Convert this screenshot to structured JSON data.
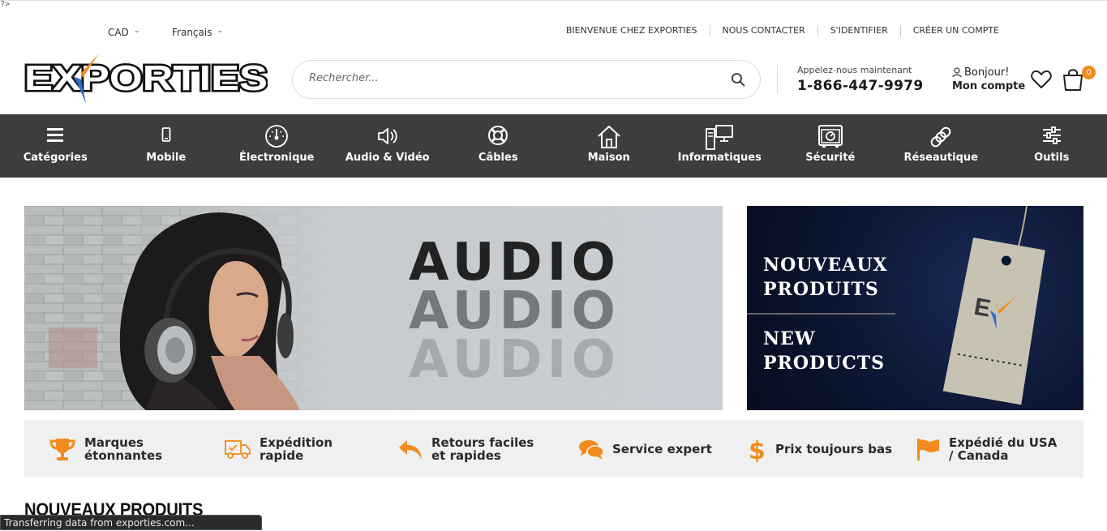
{
  "stray_text": "?>",
  "topbar": {
    "currency": "CAD",
    "language": "Français",
    "links": [
      "BIENVENUE CHEZ EXPORTIES",
      "NOUS CONTACTER",
      "S'IDENTIFIER",
      "CRÉER UN COMPTE"
    ]
  },
  "header": {
    "logo_text": "EXPORTIES",
    "search_placeholder": "Rechercher...",
    "phone_label": "Appelez-nous maintenant",
    "phone_number": "1-866-447-9979",
    "greeting": "Bonjour!",
    "account_label": "Mon compte",
    "cart_count": "0"
  },
  "nav": {
    "items": [
      {
        "label": "Catégories",
        "icon": "hamburger-icon"
      },
      {
        "label": "Mobile",
        "icon": "mobile-phone-icon"
      },
      {
        "label": "Électronique",
        "icon": "gauge-icon"
      },
      {
        "label": "Audio & Vidéo",
        "icon": "speaker-icon"
      },
      {
        "label": "Câbles",
        "icon": "lifebuoy-icon"
      },
      {
        "label": "Maison",
        "icon": "house-icon"
      },
      {
        "label": "Informatiques",
        "icon": "computer-icon"
      },
      {
        "label": "Sécurité",
        "icon": "safe-icon"
      },
      {
        "label": "Réseautique",
        "icon": "chain-icon"
      },
      {
        "label": "Outils",
        "icon": "sliders-icon"
      }
    ]
  },
  "banners": {
    "audio_words": [
      "AUDIO",
      "AUDIO",
      "AUDIO"
    ],
    "new_products_fr": [
      "NOUVEAUX",
      "PRODUITS"
    ],
    "new_products_en": [
      "NEW",
      "PRODUCTS"
    ]
  },
  "features": [
    {
      "label": "Marques étonnantes",
      "icon": "trophy-icon"
    },
    {
      "label": "Expédition rapide",
      "icon": "delivery-truck-icon"
    },
    {
      "label": "Retours faciles et rapides",
      "icon": "return-arrow-icon"
    },
    {
      "label": "Service expert",
      "icon": "chat-bubbles-icon"
    },
    {
      "label": "Prix toujours bas",
      "icon": "dollar-icon"
    },
    {
      "label": "Expédié du USA / Canada",
      "icon": "flag-icon"
    }
  ],
  "section_title": "NOUVEAUX PRODUITS",
  "status_bar": "Transferring data from exporties.com...",
  "colors": {
    "accent": "#f28b1d",
    "nav_bg": "#3d3d3d",
    "logo_blue": "#2d6ec9"
  }
}
